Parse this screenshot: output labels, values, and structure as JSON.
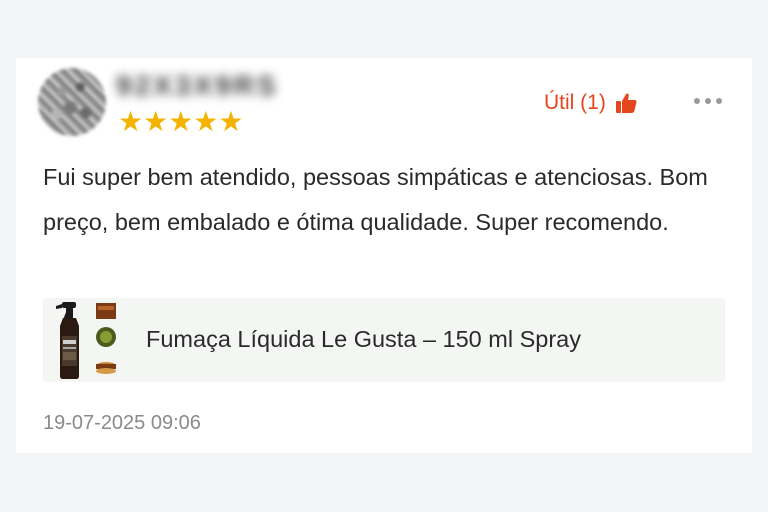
{
  "review": {
    "reviewer_name": "92X3X9RS",
    "rating": "★★★★★",
    "helpful_label": "Útil (1)",
    "text": "Fui super bem atendido, pessoas simpáticas e atenciosas. Bom preço, bem embalado e ótima qualidade. Super recomendo.",
    "product_name": "Fumaça Líquida Le Gusta – 150 ml Spray",
    "timestamp": "19-07-2025 09:06"
  },
  "colors": {
    "accent": "#e4461e",
    "star": "#f5b301",
    "product_bg": "#f4f6f4",
    "muted_text": "#8a8a8a"
  },
  "icons": {
    "helpful": "thumbs-up-icon",
    "more": "more-options-icon"
  }
}
